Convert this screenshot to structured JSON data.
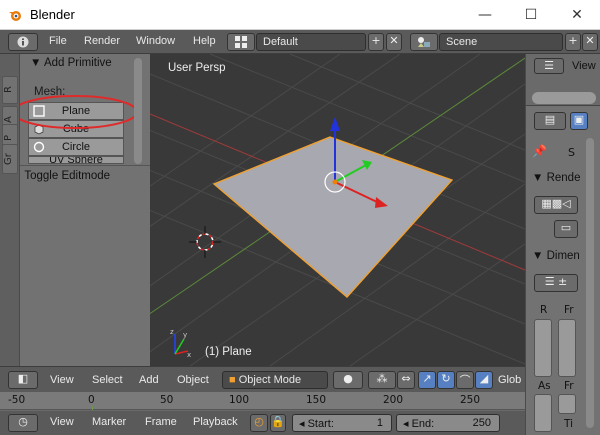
{
  "window": {
    "title": "Blender",
    "minimize": "—",
    "maximize": "☐",
    "close": "✕"
  },
  "info_header": {
    "menus": [
      "File",
      "Render",
      "Window",
      "Help"
    ],
    "screen_layout": "Default",
    "scene": "Scene"
  },
  "tool_shelf": {
    "tabs": [
      "R",
      "A",
      "P",
      "Gr"
    ],
    "panel_title": "Add Primitive",
    "section_label": "Mesh:",
    "buttons": [
      "Plane",
      "Cube",
      "Circle",
      "UV Sphere"
    ],
    "operator_panel": "Toggle Editmode"
  },
  "viewport": {
    "view_label": "User Persp",
    "object_label": "(1) Plane"
  },
  "properties": {
    "view_label": "View",
    "scene_short": "S",
    "render_panel": "Rende",
    "dimensions_panel": "Dimen",
    "res_labels": [
      "R",
      "Fr"
    ],
    "aspect_labels": [
      "As",
      "Fr"
    ],
    "time_label": "Ti"
  },
  "view3d_header": {
    "menus": [
      "View",
      "Select",
      "Add",
      "Object"
    ],
    "mode": "Object Mode",
    "orientation_short": "Glob"
  },
  "timeline": {
    "ruler": [
      "-50",
      "0",
      "50",
      "100",
      "150",
      "200",
      "250"
    ],
    "menus": [
      "View",
      "Marker",
      "Frame",
      "Playback"
    ],
    "start_label": "Start:",
    "start_value": "1",
    "end_label": "End:",
    "end_value": "250"
  },
  "colors": {
    "viewport_bg": "#393939",
    "panel_bg": "#727272",
    "header_bg": "#5a5a5a",
    "selection_outline": "#f0a030",
    "annotation_red": "#e02a2a",
    "axis_x": "#dd2222",
    "axis_y": "#22cc22",
    "axis_z": "#2233dd"
  }
}
